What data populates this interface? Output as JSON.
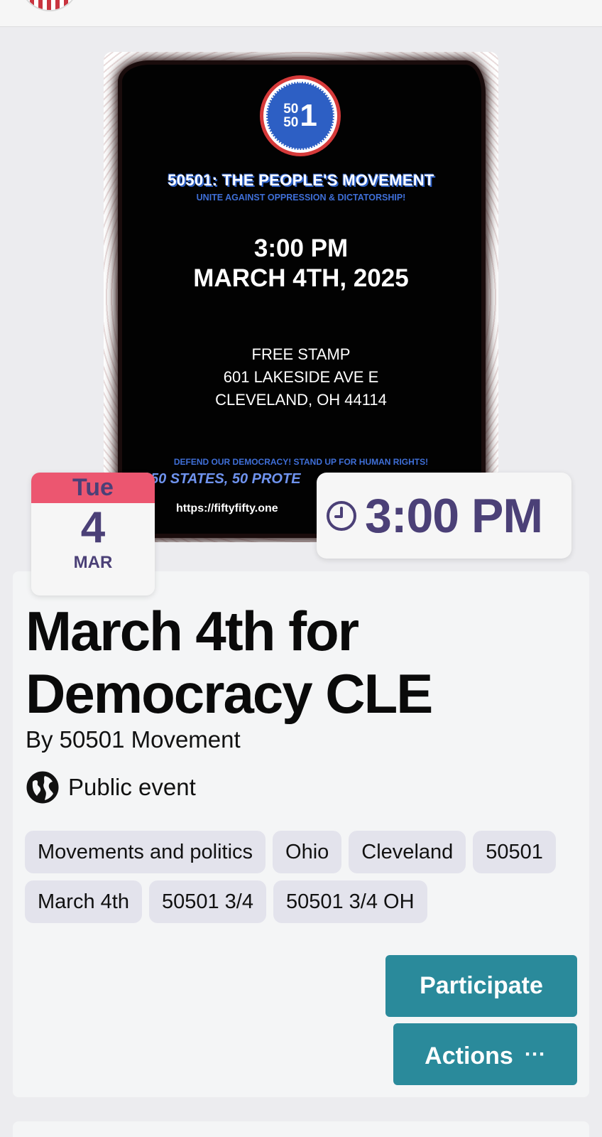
{
  "poster": {
    "seal_top": "50",
    "seal_mid": "50",
    "seal_big": "1",
    "headline": "50501: THE PEOPLE'S MOVEMENT",
    "subheadline": "UNITE AGAINST OPPRESSION & DICTATORSHIP!",
    "time": "3:00 PM",
    "date": "MARCH 4TH, 2025",
    "address_line1": "FREE STAMP",
    "address_line2": "601 LAKESIDE AVE E",
    "address_line3": "CLEVELAND, OH 44114",
    "defend": "DEFEND OUR DEMOCRACY!  STAND UP FOR HUMAN RIGHTS!",
    "states": "50 STATES, 50 PROTE",
    "url": "https://fiftyfifty.one"
  },
  "calendar": {
    "weekday": "Tue",
    "day": "4",
    "month": "MAR"
  },
  "time_badge": {
    "time": "3:00 PM",
    "icon": "clock-icon"
  },
  "event": {
    "title": "March 4th for Democracy CLE",
    "organizer": "By 50501 Movement",
    "visibility": "Public event",
    "visibility_icon": "globe-icon",
    "tags": [
      "Movements and politics",
      "Ohio",
      "Cleveland",
      "50501",
      "March 4th",
      "50501 3/4",
      "50501 3/4 OH"
    ]
  },
  "buttons": {
    "participate": "Participate",
    "actions": "Actions",
    "actions_icon": "···"
  },
  "colors": {
    "accent": "#2a8a9b",
    "badge_purple": "#4b4077",
    "calendar_red": "#ec5670"
  }
}
